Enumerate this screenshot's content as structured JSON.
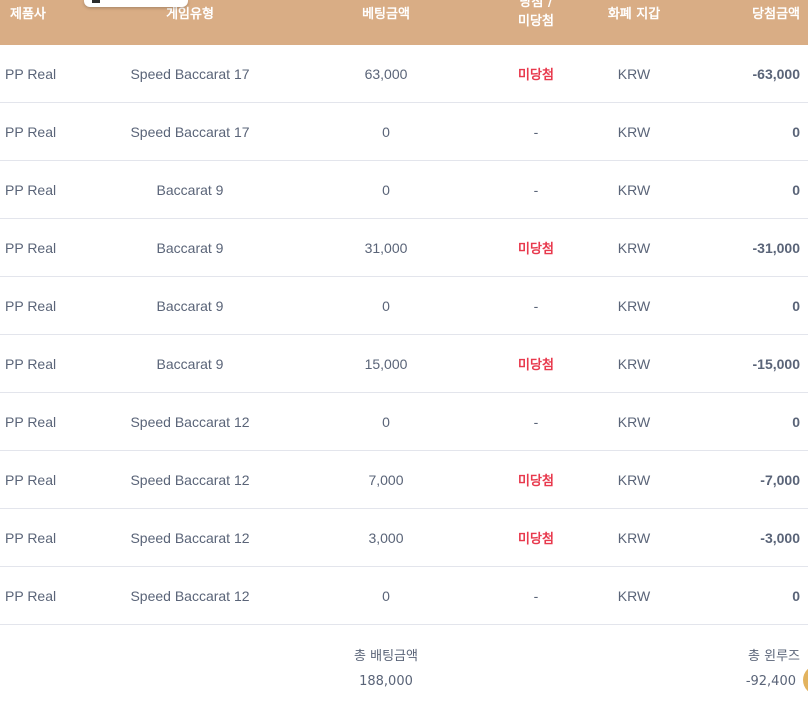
{
  "table": {
    "headers": {
      "provider": "제품사",
      "game_type": "게임유형",
      "bet_amount": "베팅금액",
      "result_line1": "당첨 /",
      "result_line2": "미당첨",
      "currency": "화폐 지갑",
      "win_amount": "당첨금액"
    },
    "rows": [
      {
        "provider": "PP Real",
        "game": "Speed Baccarat 17",
        "bet": "63,000",
        "result": "미당첨",
        "currency": "KRW",
        "win": "-63,000"
      },
      {
        "provider": "PP Real",
        "game": "Speed Baccarat 17",
        "bet": "0",
        "result": "-",
        "currency": "KRW",
        "win": "0"
      },
      {
        "provider": "PP Real",
        "game": "Baccarat 9",
        "bet": "0",
        "result": "-",
        "currency": "KRW",
        "win": "0"
      },
      {
        "provider": "PP Real",
        "game": "Baccarat 9",
        "bet": "31,000",
        "result": "미당첨",
        "currency": "KRW",
        "win": "-31,000"
      },
      {
        "provider": "PP Real",
        "game": "Baccarat 9",
        "bet": "0",
        "result": "-",
        "currency": "KRW",
        "win": "0"
      },
      {
        "provider": "PP Real",
        "game": "Baccarat 9",
        "bet": "15,000",
        "result": "미당첨",
        "currency": "KRW",
        "win": "-15,000"
      },
      {
        "provider": "PP Real",
        "game": "Speed Baccarat 12",
        "bet": "0",
        "result": "-",
        "currency": "KRW",
        "win": "0"
      },
      {
        "provider": "PP Real",
        "game": "Speed Baccarat 12",
        "bet": "7,000",
        "result": "미당첨",
        "currency": "KRW",
        "win": "-7,000"
      },
      {
        "provider": "PP Real",
        "game": "Speed Baccarat 12",
        "bet": "3,000",
        "result": "미당첨",
        "currency": "KRW",
        "win": "-3,000"
      },
      {
        "provider": "PP Real",
        "game": "Speed Baccarat 12",
        "bet": "0",
        "result": "-",
        "currency": "KRW",
        "win": "0"
      }
    ]
  },
  "summary": {
    "total_bet_label": "총 배팅금액",
    "total_bet_value": "188,000",
    "total_winloss_label": "총 윈루즈",
    "total_winloss_value": "-92,400"
  },
  "colors": {
    "header_bg": "#d9ad85",
    "lose_text": "#e8394d",
    "body_text": "#5a6478"
  }
}
